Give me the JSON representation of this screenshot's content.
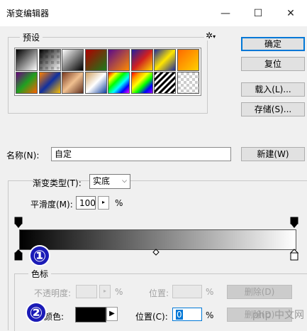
{
  "window": {
    "title": "渐变编辑器",
    "minimize": "—",
    "maximize": "☐",
    "close": "✕"
  },
  "presets": {
    "label": "预设",
    "gear_icon": "✲",
    "swatches": [
      "linear-gradient(135deg,#000,#fff)",
      "checker-black",
      "linear-gradient(135deg,#fff,#000)",
      "linear-gradient(135deg,#b00000,#1a7a1a)",
      "linear-gradient(135deg,#5a0a8a,#ff8a00)",
      "linear-gradient(135deg,#2020a0,#d02020,#ffd800)",
      "linear-gradient(135deg,#1e2a9a,#ffe600,#1e2a9a)",
      "linear-gradient(135deg,#ff6a00,#ffd000)",
      "linear-gradient(135deg,#6a0080,#20a020,#ff6000)",
      "linear-gradient(135deg,#ff8000,#1030a0,#ffc000)",
      "linear-gradient(135deg,#7a3a20,#f0c090,#603020)",
      "linear-gradient(135deg,#d0a060,#ffffff,#1040a0)",
      "linear-gradient(135deg,#ff0000,#ffff00,#00ff00,#00ffff,#0000ff,#ff00ff)",
      "linear-gradient(135deg,#ff0000,#ff9900,#ffff00,#00ff00,#0000ff,#9900ff)",
      "repeating-linear-gradient(135deg,#000 0 3px,#fff 3px 6px)",
      "checker-plain"
    ]
  },
  "buttons": {
    "ok": "确定",
    "reset": "复位",
    "load": "载入(L)...",
    "save": "存储(S)...",
    "new": "新建(W)"
  },
  "name": {
    "label": "名称(N):",
    "value": "自定"
  },
  "gradient_type": {
    "label": "渐变类型(T):",
    "value": "实底",
    "options": [
      "实底"
    ]
  },
  "smoothness": {
    "label": "平滑度(M):",
    "value": "100",
    "unit": "%"
  },
  "gradient_bar": {
    "start_color": "#000000",
    "end_color": "#ffffff",
    "midpoint": 0.5
  },
  "stops": {
    "group_label": "色标",
    "opacity_label": "不透明度:",
    "opacity_unit": "%",
    "location_label": "位置:",
    "location_unit": "%",
    "delete_label": "删除(D)",
    "color_label": "颜色:",
    "color_value": "#000000",
    "color_location_label": "位置(C):",
    "color_location_value": "0",
    "color_location_unit": "%",
    "color_delete_label": "删除(D)"
  },
  "annotations": {
    "one": "①",
    "two": "②"
  },
  "watermark": "php 中文网"
}
